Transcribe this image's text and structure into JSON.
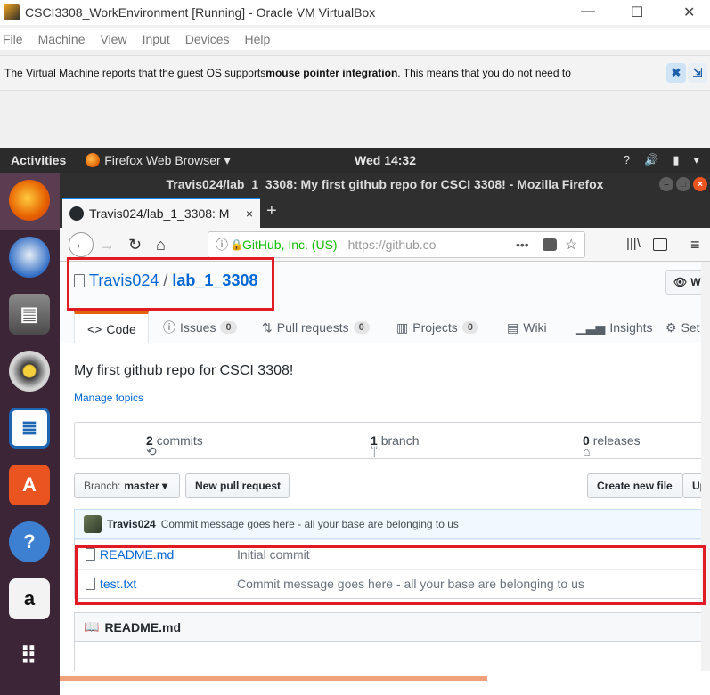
{
  "vbox": {
    "title": "CSCI3308_WorkEnvironment [Running] - Oracle VM VirtualBox",
    "window_controls": {
      "minimize": "—",
      "maximize": "☐",
      "close": "✕"
    },
    "menu": [
      "File",
      "Machine",
      "View",
      "Input",
      "Devices",
      "Help"
    ],
    "notice": {
      "prefix": "The Virtual Machine reports that the guest OS supports ",
      "bold": "mouse pointer integration",
      "suffix": ". This means that you do not need to"
    }
  },
  "ubuntu": {
    "activities": "Activities",
    "app": "Firefox Web Browser ▾",
    "clock": "Wed 14:32",
    "tray": [
      "?",
      "🔊",
      "▮",
      "▾"
    ]
  },
  "launcher": {
    "icons": [
      "firefox-icon",
      "thunderbird-icon",
      "files-icon",
      "rhythmbox-icon",
      "writer-icon",
      "software-icon",
      "help-icon",
      "amazon-icon",
      "apps-grid-icon"
    ]
  },
  "firefox": {
    "window_title": "Travis024/lab_1_3308: My first github repo for CSCI 3308! - Mozilla Firefox",
    "tab_label": "Travis024/lab_1_3308: M",
    "tab_close": "×",
    "new_tab": "+",
    "identity": "GitHub, Inc. (US)",
    "url": "https://github.co",
    "nav": {
      "back": "←",
      "forward": "→",
      "reload": "↻",
      "home": "⌂",
      "more": "•••",
      "menu": "≡"
    }
  },
  "github": {
    "owner": "Travis024",
    "separator": "/",
    "repo": "lab_1_3308",
    "watch_label": "W",
    "tabs": [
      {
        "label": "Code",
        "count": ""
      },
      {
        "label": "Issues",
        "count": "0"
      },
      {
        "label": "Pull requests",
        "count": "0"
      },
      {
        "label": "Projects",
        "count": "0"
      },
      {
        "label": "Wiki",
        "count": ""
      },
      {
        "label": "Insights",
        "count": ""
      },
      {
        "label": "Set",
        "count": ""
      }
    ],
    "description": "My first github repo for CSCI 3308!",
    "manage_topics": "Manage topics",
    "summary": {
      "commits_n": "2",
      "commits_label": "commits",
      "branch_n": "1",
      "branch_label": "branch",
      "releases_n": "0",
      "releases_label": "releases"
    },
    "branch_label": "Branch:",
    "branch_value": "master ▾",
    "new_pr": "New pull request",
    "create_file": "Create new file",
    "upload": "Up",
    "commit": {
      "author": "Travis024",
      "message": "Commit message goes here - all your base are belonging to us"
    },
    "files": [
      {
        "name": "README.md",
        "message": "Initial commit"
      },
      {
        "name": "test.txt",
        "message": "Commit message goes here - all your base are belonging to us"
      }
    ],
    "readme_title": "README.md"
  }
}
